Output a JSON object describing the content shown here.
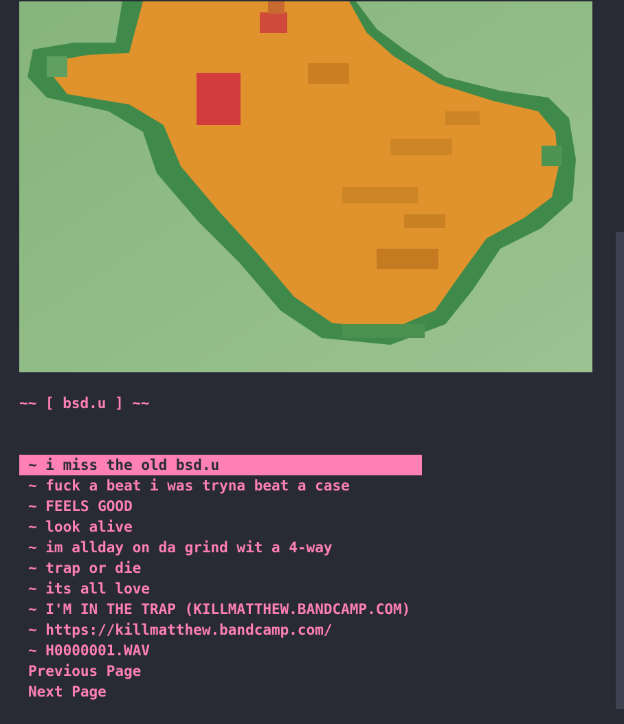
{
  "banner": {
    "alt": "pixelated orange creature on green background"
  },
  "site": {
    "title": "~~ [ bsd.u ] ~~"
  },
  "menu": {
    "items": [
      {
        "label": "~ i miss the old bsd.u",
        "selected": true
      },
      {
        "label": "~ fuck a beat i was tryna beat a case"
      },
      {
        "label": "~ FEELS GOOD"
      },
      {
        "label": "~ look alive"
      },
      {
        "label": "~ im allday on da grind wit a 4-way"
      },
      {
        "label": "~ trap or die"
      },
      {
        "label": "~ its all love"
      },
      {
        "label": "~ I'M IN THE TRAP (KILLMATTHEW.BANDCAMP.COM)"
      },
      {
        "label": "~ https://killmatthew.bandcamp.com/"
      },
      {
        "label": "~ H0000001.WAV"
      }
    ],
    "previous_page": "Previous Page",
    "next_page": "Next Page"
  },
  "colors": {
    "background": "#282a36",
    "accent": "#ff80b4",
    "scrollbar_thumb": "#3e4150"
  }
}
